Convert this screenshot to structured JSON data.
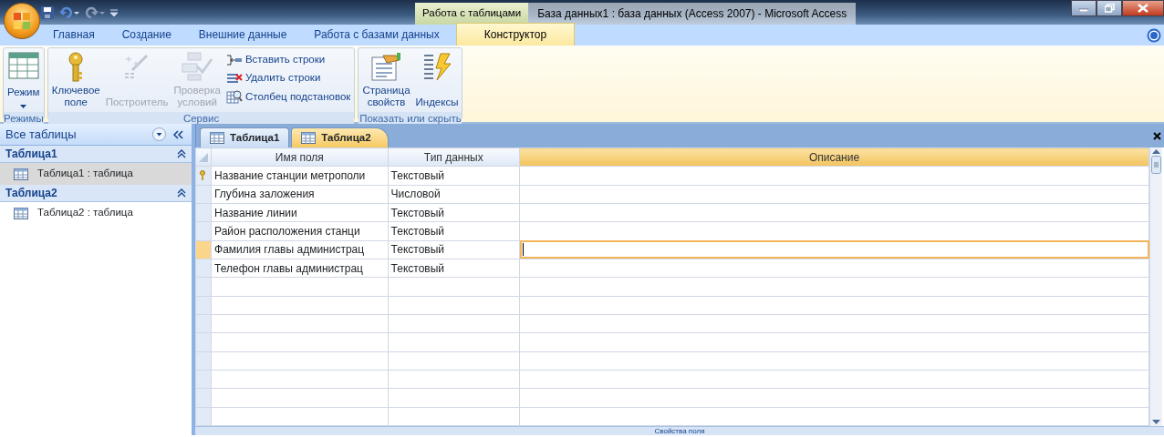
{
  "title_bar": {
    "context_tab": "Работа с таблицами",
    "title": "База данных1 : база данных (Access 2007)  -  Microsoft Access"
  },
  "ribbon_tabs": [
    {
      "label": "Главная",
      "selected": false
    },
    {
      "label": "Создание",
      "selected": false
    },
    {
      "label": "Внешние данные",
      "selected": false
    },
    {
      "label": "Работа с базами данных",
      "selected": false
    },
    {
      "label": "Конструктор",
      "selected": true
    }
  ],
  "ribbon_groups": [
    {
      "label": "Режимы",
      "buttons": [
        {
          "kind": "dropdown",
          "label": "Режим",
          "disabled": false
        }
      ]
    },
    {
      "label": "Сервис",
      "buttons": [
        {
          "kind": "large",
          "label": "Ключевое поле",
          "disabled": false
        },
        {
          "kind": "large",
          "label": "Построитель",
          "disabled": true
        },
        {
          "kind": "large",
          "label": "Проверка условий",
          "disabled": true
        },
        {
          "kind": "small",
          "label": "Вставить строки",
          "disabled": false
        },
        {
          "kind": "small",
          "label": "Удалить строки",
          "disabled": false
        },
        {
          "kind": "small",
          "label": "Столбец  подстановок",
          "disabled": false
        }
      ]
    },
    {
      "label": "Показать или скрыть",
      "buttons": [
        {
          "kind": "large",
          "label": "Страница свойств",
          "disabled": false
        },
        {
          "kind": "large",
          "label": "Индексы",
          "disabled": false
        }
      ]
    }
  ],
  "nav_pane": {
    "title": "Все таблицы",
    "groups": [
      {
        "label": "Таблица1",
        "items": [
          {
            "label": "Таблица1 : таблица",
            "selected": true
          }
        ]
      },
      {
        "label": "Таблица2",
        "items": [
          {
            "label": "Таблица2 : таблица",
            "selected": false
          }
        ]
      }
    ]
  },
  "document_tabs": [
    {
      "label": "Таблица1",
      "selected": false
    },
    {
      "label": "Таблица2",
      "selected": true
    }
  ],
  "table": {
    "columns": [
      "Имя поля",
      "Тип данных",
      "Описание"
    ],
    "rows": [
      {
        "field": "Название станции метрополи",
        "type": "Текстовый",
        "primary_key": true,
        "selected": false
      },
      {
        "field": "Глубина заложения",
        "type": "Числовой",
        "primary_key": false,
        "selected": false
      },
      {
        "field": "Название линии",
        "type": "Текстовый",
        "primary_key": false,
        "selected": false
      },
      {
        "field": "Район расположения станци",
        "type": "Текстовый",
        "primary_key": false,
        "selected": false
      },
      {
        "field": "Фамилия главы администрац",
        "type": "Текстовый",
        "primary_key": false,
        "selected": true
      },
      {
        "field": "Телефон главы администрац",
        "type": "Текстовый",
        "primary_key": false,
        "selected": false
      }
    ]
  },
  "properties_bar": {
    "label": "Свойства поля"
  }
}
